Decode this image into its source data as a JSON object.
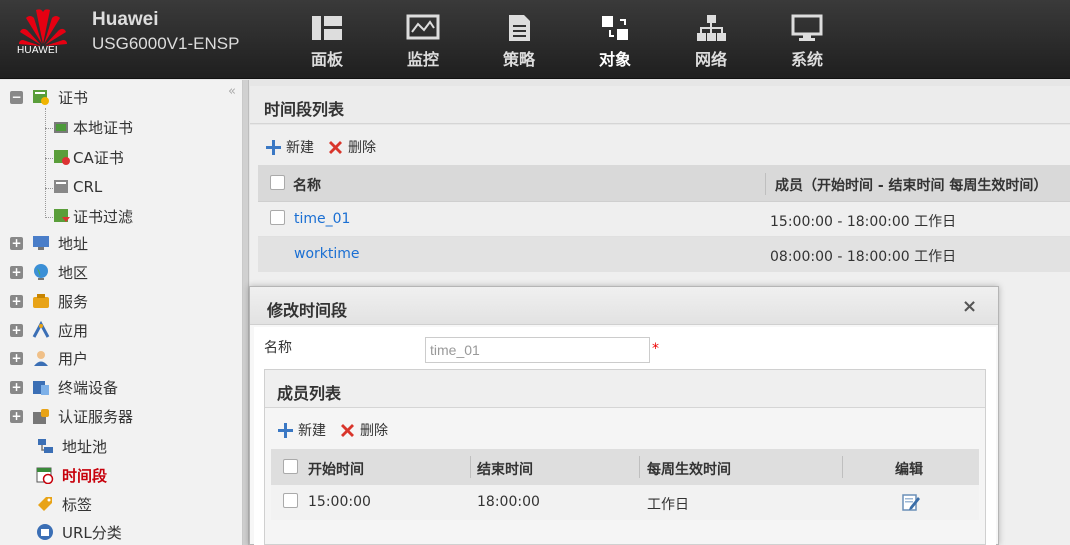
{
  "brand": {
    "logo_text": "HUAWEI",
    "name": "Huawei",
    "model": "USG6000V1-ENSP"
  },
  "nav": [
    {
      "label": "面板",
      "icon": "dashboard-icon"
    },
    {
      "label": "监控",
      "icon": "monitor-icon"
    },
    {
      "label": "策略",
      "icon": "policy-icon"
    },
    {
      "label": "对象",
      "icon": "object-icon",
      "active": true
    },
    {
      "label": "网络",
      "icon": "network-icon"
    },
    {
      "label": "系统",
      "icon": "system-icon"
    }
  ],
  "sidebar": {
    "collapse": "«",
    "items": [
      {
        "label": "证书",
        "toggle": "−"
      },
      {
        "label": "本地证书"
      },
      {
        "label": "CA证书"
      },
      {
        "label": "CRL"
      },
      {
        "label": "证书过滤"
      },
      {
        "label": "地址",
        "toggle": "+"
      },
      {
        "label": "地区",
        "toggle": "+"
      },
      {
        "label": "服务",
        "toggle": "+"
      },
      {
        "label": "应用",
        "toggle": "+"
      },
      {
        "label": "用户",
        "toggle": "+"
      },
      {
        "label": "终端设备",
        "toggle": "+"
      },
      {
        "label": "认证服务器",
        "toggle": "+"
      },
      {
        "label": "地址池"
      },
      {
        "label": "时间段",
        "active": true
      },
      {
        "label": "标签"
      },
      {
        "label": "URL分类"
      }
    ]
  },
  "main": {
    "title": "时间段列表",
    "toolbar": {
      "new_label": "新建",
      "delete_label": "删除"
    },
    "columns": {
      "name": "名称",
      "members": "成员（开始时间 - 结束时间 每周生效时间）"
    },
    "rows": [
      {
        "name": "time_01",
        "members": "15:00:00 - 18:00:00 工作日"
      },
      {
        "name": "worktime",
        "members": "08:00:00 - 18:00:00 工作日"
      }
    ]
  },
  "dialog": {
    "title": "修改时间段",
    "close": "×",
    "name_label": "名称",
    "name_value": "time_01",
    "required_mark": "*",
    "member_list": {
      "title": "成员列表",
      "toolbar": {
        "new_label": "新建",
        "delete_label": "删除"
      },
      "columns": {
        "start": "开始时间",
        "end": "结束时间",
        "weekly": "每周生效时间",
        "edit": "编辑"
      },
      "rows": [
        {
          "start": "15:00:00",
          "end": "18:00:00",
          "weekly": "工作日"
        }
      ]
    }
  },
  "colors": {
    "accent": "#c7000b",
    "link": "#1a6fd3",
    "header_bg": "#2b2b2b"
  }
}
